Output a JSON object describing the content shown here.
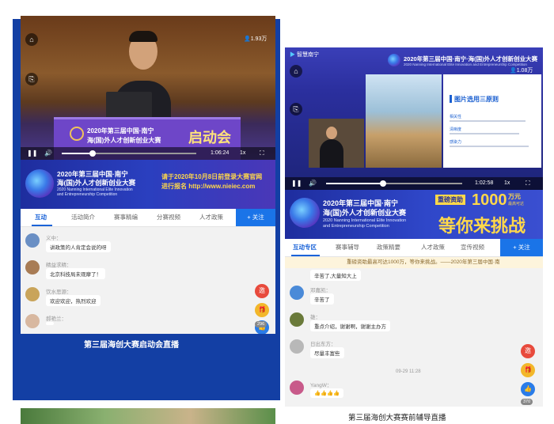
{
  "left": {
    "video": {
      "views": "1.93万",
      "time": "1:06:24",
      "speed": "1x",
      "progress": 0.23
    },
    "podium": {
      "year_title": "2020年第三届中国·南宁",
      "title_line2": "海(国)外人才创新创业大赛",
      "event": "启动会"
    },
    "banner": {
      "title1": "2020年第三届中国·南宁",
      "title2": "海(国)外人才创新创业大赛",
      "sub1": "2020 Nanning International Elite Innovation",
      "sub2": "and Entrepreneurship Competition",
      "notice1": "请于2020年10月8日前登录大赛官网",
      "notice2": "进行报名  http://www.nieiec.com"
    },
    "tabs": [
      "互动",
      "活动简介",
      "赛事精编",
      "分赛视频",
      "人才政策"
    ],
    "follow": "+ 关注",
    "messages": [
      {
        "name": "义中：",
        "text": "讲政策的人肯定会说的呀"
      },
      {
        "name": "精益求精：",
        "text": "北京科技局未观摩了！"
      },
      {
        "name": "饮水思源：",
        "text": "欢迎欢迎，热烈欢迎"
      },
      {
        "name": "郝艳兰：",
        "text": ""
      }
    ],
    "side_buttons": [
      "邀",
      "",
      "赞"
    ],
    "like_count": "296",
    "caption": "第三届海创大赛启动会直播"
  },
  "right": {
    "video": {
      "brand": "智慧南宁",
      "views": "1.08万",
      "time": "1:02:58",
      "speed": "1x",
      "progress": 0.42
    },
    "header": {
      "title": "2020年第三届中国·南宁·海(国)外人才创新创业大赛",
      "sub": "2020 Nanning International Elite Innovation and Entrepreneurship Competition"
    },
    "slide": {
      "heading": "图片选用三原则",
      "h1": "相关性",
      "h2": "清晰度",
      "h3": "感染力"
    },
    "banner": {
      "title1": "2020年第三届中国·南宁",
      "title2": "海(国)外人才创新创业大赛",
      "sub1": "2020 Nanning International Elite Innovation",
      "sub2": "and Entrepreneurship Competition",
      "tag": "重磅资助",
      "amount": "1000",
      "unit": "万元",
      "slogan": "等你来挑战",
      "small": "最高可达"
    },
    "tabs": [
      "互动专区",
      "赛事辅导",
      "政策精要",
      "人才政策",
      "宣传视频"
    ],
    "follow": "+ 关注",
    "ticker": "重磅资助最高可达1000万，等你来挑战。——2020年第三届中国·南",
    "messages": [
      {
        "name": "",
        "text": "辛苦了,大量知大上"
      },
      {
        "name": "邓嘉凯：",
        "text": "辛苦了"
      },
      {
        "name": "雄：",
        "text": "重点介绍，谢谢啊，谢谢主办方"
      },
      {
        "name": "日出东方：",
        "text": "尽量丰富些"
      },
      {
        "name": "YangW：",
        "text": "👍👍👍👍"
      }
    ],
    "timestamp": "09-29 11:28",
    "side_buttons": [
      "邀",
      "",
      "赞"
    ],
    "like_count": "370",
    "caption": "第三届海创大赛赛前辅导直播"
  },
  "colors": {
    "panel_blue": "#133fa4",
    "accent": "#1a63d8",
    "follow": "#1a74e8"
  }
}
